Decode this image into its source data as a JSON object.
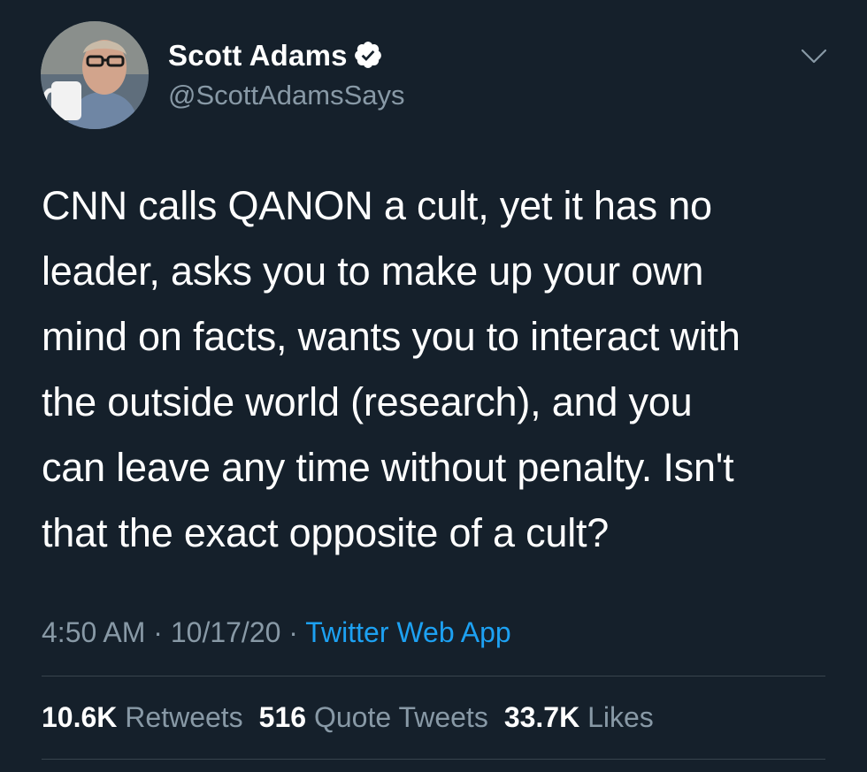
{
  "author": {
    "display_name": "Scott Adams",
    "handle": "@ScottAdamsSays",
    "verified": true
  },
  "tweet": {
    "lines": [
      "CNN calls QANON a cult, yet it has no",
      "leader, asks you to make up your own",
      "mind on facts, wants you to interact with",
      "the outside world (research), and you",
      "can leave any time without penalty. Isn't",
      "that the exact opposite of a cult?"
    ]
  },
  "meta": {
    "time": "4:50 AM",
    "sep1": " · ",
    "date": "10/17/20",
    "sep2": " · ",
    "source": "Twitter Web App"
  },
  "stats": {
    "retweets": {
      "count": "10.6K",
      "label": "Retweets"
    },
    "quotes": {
      "count": "516",
      "label": "Quote Tweets"
    },
    "likes": {
      "count": "33.7K",
      "label": "Likes"
    }
  },
  "colors": {
    "background": "#15202b",
    "text": "#ffffff",
    "secondary": "#8899a6",
    "link": "#1da1f2",
    "divider": "#38444d"
  },
  "icons": {
    "verified": "verified-badge-icon",
    "caret": "chevron-down-icon"
  }
}
